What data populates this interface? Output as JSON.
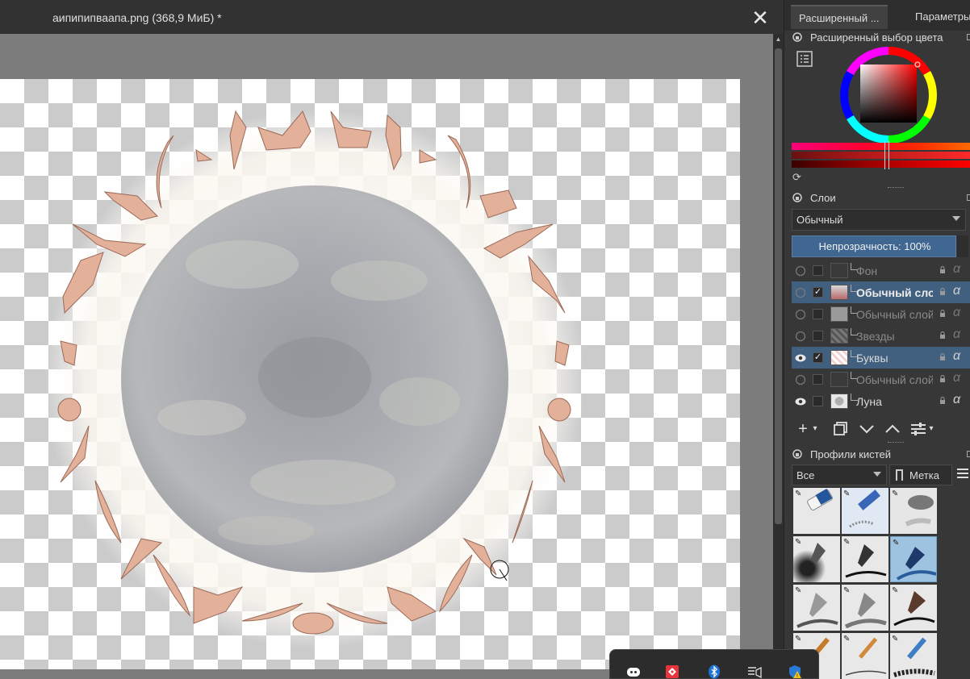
{
  "document": {
    "tab_title": "аипипипваапа.png (368,9 МиБ) *",
    "close_glyph": "✕"
  },
  "dock": {
    "tabs": [
      "Расширенный ...",
      "Параметры"
    ],
    "color_selector": {
      "title": "Расширенный выбор цвета",
      "settings_icon": "list-settings-icon",
      "refresh_icon": "refresh-icon",
      "current_color": "#ff2020",
      "hue_color": "#ff0000"
    },
    "layers": {
      "title": "Слои",
      "blend_mode": "Обычный",
      "opacity_label": "Непрозрачность:  100%",
      "items": [
        {
          "name": "Фон",
          "visible": false,
          "checked": false,
          "selected": false,
          "dim": true,
          "bold": false
        },
        {
          "name": "Обычный слой",
          "visible": false,
          "checked": true,
          "selected": true,
          "dim": false,
          "bold": true
        },
        {
          "name": "Обычный слой",
          "visible": false,
          "checked": false,
          "selected": false,
          "dim": true,
          "bold": false
        },
        {
          "name": "Звезды",
          "visible": false,
          "checked": false,
          "selected": false,
          "dim": true,
          "bold": false
        },
        {
          "name": "Буквы",
          "visible": true,
          "checked": true,
          "selected": true,
          "dim": false,
          "bold": false
        },
        {
          "name": "Обычный слой",
          "visible": false,
          "checked": false,
          "selected": false,
          "dim": true,
          "bold": false
        },
        {
          "name": "Луна",
          "visible": true,
          "checked": false,
          "selected": false,
          "dim": false,
          "bold": false
        }
      ],
      "alpha_glyph": "α",
      "toolbar": [
        "add-layer-icon",
        "duplicate-layer-icon",
        "move-down-icon",
        "move-up-icon",
        "layer-properties-icon"
      ]
    },
    "brushes": {
      "title": "Профили кистей",
      "filter": "Все",
      "tag": "Метка",
      "presets": [
        "eraser-soft",
        "eraser-block",
        "eraser-smudge",
        "ink-gpen",
        "ink-pen",
        "ink-fine-selected",
        "pencil-1",
        "pencil-2",
        "pencil-3",
        "brush-1",
        "brush-2",
        "pencil-4"
      ]
    }
  },
  "tray": {
    "icons": [
      "discord-icon",
      "anydesk-icon",
      "bluetooth-icon",
      "media-icon",
      "security-warning-icon"
    ]
  }
}
